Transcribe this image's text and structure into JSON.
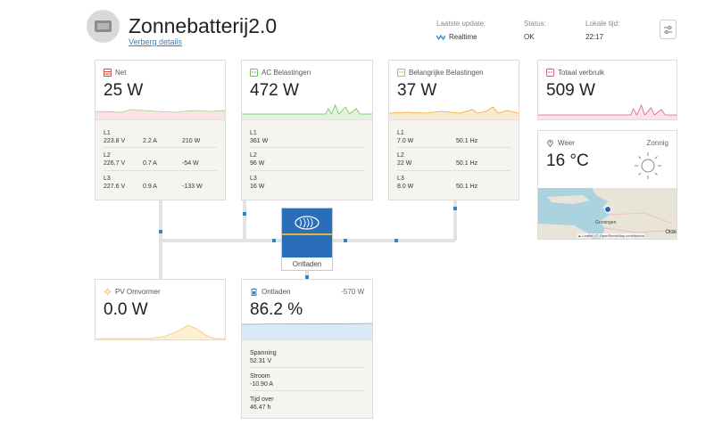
{
  "header": {
    "title": "Zonnebatterij2.0",
    "toggle_details": "Verberg details",
    "last_update_label": "Laatste update:",
    "last_update_value": "Realtime",
    "status_label": "Status:",
    "status_value": "OK",
    "local_time_label": "Lokale tijd:",
    "local_time_value": "22:17"
  },
  "net": {
    "title": "Net",
    "power": "25 W",
    "phases": [
      {
        "name": "L1",
        "voltage": "223.8 V",
        "current": "2.2 A",
        "power": "210 W"
      },
      {
        "name": "L2",
        "voltage": "226.7 V",
        "current": "0.7 A",
        "power": "-54 W"
      },
      {
        "name": "L3",
        "voltage": "227.6 V",
        "current": "0.9 A",
        "power": "-133 W"
      }
    ]
  },
  "ac_loads": {
    "title": "AC Belastingen",
    "power": "472 W",
    "phases": [
      {
        "name": "L1",
        "power": "361 W"
      },
      {
        "name": "L2",
        "power": "96 W"
      },
      {
        "name": "L3",
        "power": "16 W"
      }
    ]
  },
  "critical_loads": {
    "title": "Belangrijke Belastingen",
    "power": "37 W",
    "phases": [
      {
        "name": "L1",
        "power": "7.0 W",
        "freq": "50.1 Hz"
      },
      {
        "name": "L2",
        "power": "22 W",
        "freq": "50.1 Hz"
      },
      {
        "name": "L3",
        "power": "8.0 W",
        "freq": "50.1 Hz"
      }
    ]
  },
  "total": {
    "title": "Totaal verbruik",
    "power": "509 W"
  },
  "weather": {
    "title": "Weer",
    "condition": "Zonnig",
    "temperature": "16 °C",
    "map_label_city": "Groningen",
    "map_label_edge": "Olde",
    "map_attribution": "▲ Leaflet | © OpenStreetMap contributors"
  },
  "inverter": {
    "state": "Ontladen"
  },
  "pv": {
    "title": "PV Omvormer",
    "power": "0.0 W"
  },
  "battery": {
    "title": "Ontladen",
    "power": "-570 W",
    "soc": "86.2 %",
    "soc_fraction": 0.862,
    "rows": [
      {
        "label": "Spanning",
        "value": "52.31 V"
      },
      {
        "label": "Stroom",
        "value": "-10.90 A"
      },
      {
        "label": "Tijd over",
        "value": "46.47 h"
      }
    ]
  },
  "colors": {
    "grid": "#d9534f",
    "ac": "#6fbf5a",
    "critical": "#f0a33a",
    "total": "#e0607a",
    "pv": "#f0b840",
    "battery": "#3a7fc4",
    "inverter": "#2a6db8",
    "wire_dot": "#2f86c4"
  }
}
